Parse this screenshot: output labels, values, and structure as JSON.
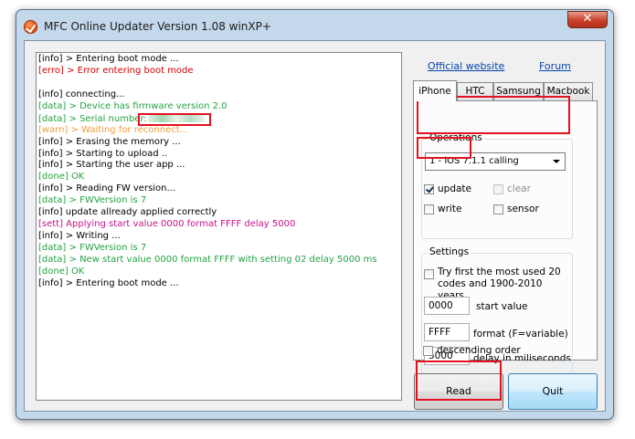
{
  "window": {
    "title": "MFC Online Updater Version 1.08 winXP+",
    "close_glyph": "✕"
  },
  "log": [
    {
      "tag": "info",
      "text": "[info] > Entering boot mode ..."
    },
    {
      "tag": "erro",
      "text": "[erro] > Error entering boot mode"
    },
    {
      "tag": "blank",
      "text": ""
    },
    {
      "tag": "info",
      "text": "[info] connecting..."
    },
    {
      "tag": "data",
      "text": "[data] > Device has firmware version 2.0"
    },
    {
      "tag": "data",
      "text": "[data] > Serial number:"
    },
    {
      "tag": "warn",
      "text": "[warn] > Waiting for reconnect..."
    },
    {
      "tag": "info",
      "text": "[info] > Erasing the memory ..."
    },
    {
      "tag": "info",
      "text": "[info] > Starting to upload .."
    },
    {
      "tag": "info",
      "text": "[info] > Starting the user app ..."
    },
    {
      "tag": "done",
      "text": "[done] OK"
    },
    {
      "tag": "info",
      "text": "[info] > Reading FW version..."
    },
    {
      "tag": "data",
      "text": "[data] > FWVersion is 7"
    },
    {
      "tag": "info",
      "text": "[info] update allready applied correctly"
    },
    {
      "tag": "sett",
      "text": "[sett] Applying start value 0000 format FFFF delay 5000"
    },
    {
      "tag": "info",
      "text": "[info] > Writing ..."
    },
    {
      "tag": "data",
      "text": "[data] > FWVersion is 7"
    },
    {
      "tag": "data",
      "text": "[data] > New start value 0000 format FFFF with setting 02 delay 5000 ms"
    },
    {
      "tag": "done",
      "text": "[done] OK"
    },
    {
      "tag": "info",
      "text": "[info] > Entering boot mode ..."
    }
  ],
  "links": {
    "official": "Official website",
    "forum": "Forum"
  },
  "tabs": [
    "iPhone",
    "HTC",
    "Samsung",
    "Macbook"
  ],
  "operations": {
    "label": "Operations",
    "selected": "1 - iOS 7.1.1 calling",
    "checkboxes": {
      "update": {
        "label": "update",
        "checked": true
      },
      "clear": {
        "label": "clear",
        "checked": false,
        "disabled": true
      },
      "write": {
        "label": "write",
        "checked": false
      },
      "sensor": {
        "label": "sensor",
        "checked": false
      }
    }
  },
  "settings": {
    "label": "Settings",
    "try_first": "Try first the most used 20 codes and 1900-2010 years",
    "start_value": "0000",
    "start_value_label": "start value",
    "format": "FFFF",
    "format_label": "format (F=variable)",
    "delay": "5000",
    "delay_label": "delay in miliseconds",
    "descending": "descending order"
  },
  "buttons": {
    "read": "Read",
    "quit": "Quit"
  },
  "colors": {
    "highlight": "#e3121f",
    "info": "#000000",
    "erro": "#d40000",
    "data": "#25a244",
    "warn": "#f29b3c",
    "done": "#25a244",
    "sett": "#c8118e"
  }
}
